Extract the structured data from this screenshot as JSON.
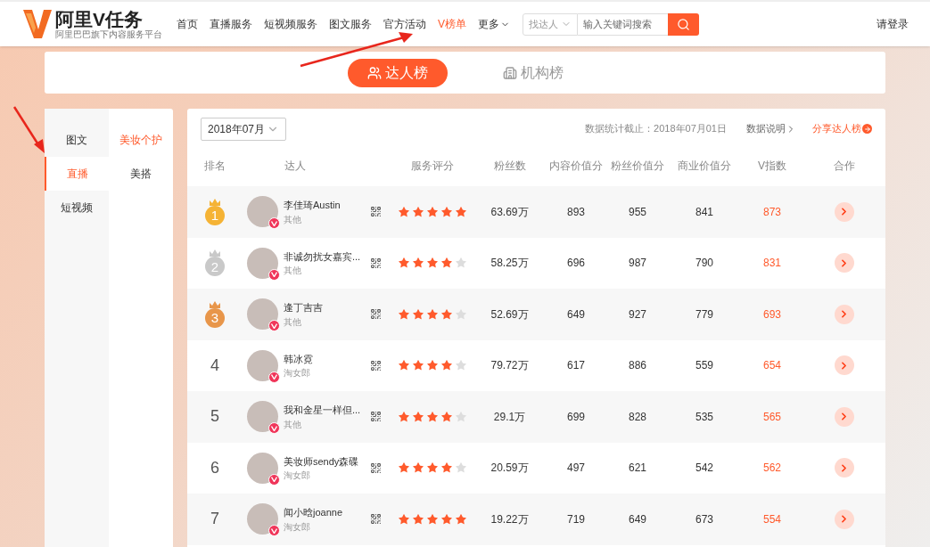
{
  "header": {
    "logo": {
      "title": "阿里V任务",
      "tagline": "阿里巴巴旗下内容服务平台"
    },
    "nav": [
      {
        "label": "首页",
        "selected": false
      },
      {
        "label": "直播服务",
        "selected": false
      },
      {
        "label": "短视频服务",
        "selected": false
      },
      {
        "label": "图文服务",
        "selected": false
      },
      {
        "label": "官方活动",
        "selected": false
      },
      {
        "label": "V榜单",
        "selected": true
      }
    ],
    "more": "更多",
    "search": {
      "scope": "找达人",
      "placeholder": "输入关键词搜索"
    },
    "login": "请登录"
  },
  "board_tabs": [
    {
      "label": "达人榜",
      "kind": "person",
      "selected": true
    },
    {
      "label": "机构榜",
      "kind": "building",
      "selected": false
    }
  ],
  "sidebar": {
    "categories": [
      {
        "label": "图文",
        "selected": false
      },
      {
        "label": "直播",
        "selected": true
      },
      {
        "label": "短视频",
        "selected": false
      }
    ],
    "subcategories": [
      {
        "label": "美妆个护",
        "selected": true
      },
      {
        "label": "美搭",
        "selected": false
      }
    ]
  },
  "table": {
    "month": "2018年07月",
    "cutoff": "数据统计截止：2018年07月01日",
    "explain": "数据说明",
    "share": "分享达人榜",
    "columns": [
      "排名",
      "达人",
      "服务评分",
      "粉丝数",
      "内容价值分",
      "粉丝价值分",
      "商业价值分",
      "V指数",
      "合作"
    ],
    "rows": [
      {
        "rank": "1",
        "kind": "medal",
        "color": "#f5b335",
        "name": "李佳琦Austin",
        "source": "其他",
        "stars": 5,
        "fans": "63.69万",
        "content": "893",
        "fan_value": "955",
        "business": "841",
        "v_index": "873"
      },
      {
        "rank": "2",
        "kind": "medal",
        "color": "#c9c9c9",
        "name": "非诚勿扰女嘉宾...",
        "source": "其他",
        "stars": 4,
        "fans": "58.25万",
        "content": "696",
        "fan_value": "987",
        "business": "790",
        "v_index": "831"
      },
      {
        "rank": "3",
        "kind": "medal",
        "color": "#e8964a",
        "name": "逢丁吉吉",
        "source": "其他",
        "stars": 4,
        "fans": "52.69万",
        "content": "649",
        "fan_value": "927",
        "business": "779",
        "v_index": "693"
      },
      {
        "rank": "4",
        "kind": "number",
        "name": "韩冰霓",
        "source": "淘女郎",
        "stars": 4,
        "fans": "79.72万",
        "content": "617",
        "fan_value": "886",
        "business": "559",
        "v_index": "654"
      },
      {
        "rank": "5",
        "kind": "number",
        "name": "我和金星一样但...",
        "source": "其他",
        "stars": 4,
        "fans": "29.1万",
        "content": "699",
        "fan_value": "828",
        "business": "535",
        "v_index": "565"
      },
      {
        "rank": "6",
        "kind": "number",
        "name": "美妆师sendy森碟",
        "source": "淘女郎",
        "stars": 4,
        "fans": "20.59万",
        "content": "497",
        "fan_value": "621",
        "business": "542",
        "v_index": "562"
      },
      {
        "rank": "7",
        "kind": "number",
        "name": "闻小晗joanne",
        "source": "淘女郎",
        "stars": 5,
        "fans": "19.22万",
        "content": "719",
        "fan_value": "649",
        "business": "673",
        "v_index": "554"
      }
    ]
  }
}
